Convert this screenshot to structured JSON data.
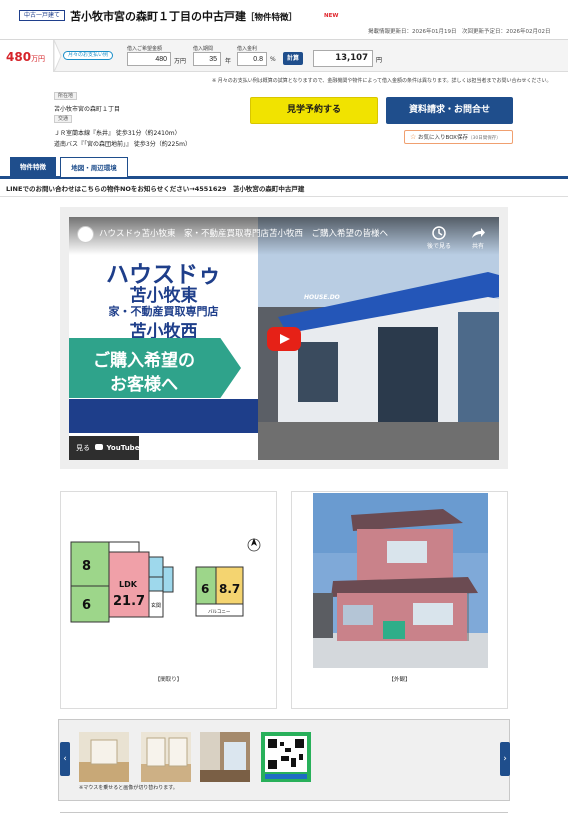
{
  "header": {
    "type_badge": "中古一戸建て",
    "title": "苫小牧市宮の森町１丁目の中古戸建",
    "title_suffix": "［物件特徴］",
    "new_badge": "NEW",
    "dates": "掲載情報更新日：2026年01月19日　次回更新予定日：2026年02月02日"
  },
  "price": {
    "value": "480",
    "unit": "万円",
    "monthly_tag": "月々のお支払い例"
  },
  "loan": {
    "amount_label": "借入ご希望金額",
    "amount_value": "480",
    "amount_unit": "万円",
    "period_label": "借入期間",
    "period_value": "35",
    "period_unit": "年",
    "rate_label": "借入金利",
    "rate_value": "0.8",
    "rate_unit": "%",
    "calc_button": "計算",
    "result_value": "13,107",
    "result_unit": "円"
  },
  "note_top": "※ 月々のお支払い例は概算の試算となりますので、金融機関や物件によって借入金額の条件は異なります。詳しくは担当者までお問い合わせください。",
  "property": {
    "address_tag": "所在地",
    "address": "苫小牧市宮の森町１丁目",
    "traffic_tag": "交通",
    "traffic_1": "ＪＲ室蘭本線『糸井』 徒歩31分（約2410m）",
    "traffic_2": "道南バス『「宮の森団地前」』 徒歩3分（約225m）"
  },
  "actions": {
    "visit": "見学予約する",
    "request": "資料請求・お問合せ",
    "favorite": "お気に入りBOX保存",
    "favorite_note": "（30日間保存）"
  },
  "tabs": [
    {
      "label": "物件特徴"
    },
    {
      "label": "地図・周辺環境"
    }
  ],
  "line_notice": "LINEでのお問い合わせはこちらの物件NOをお知らせください→4551629　苫小牧宮の森町中古戸建",
  "video": {
    "title": "ハウスドゥ苫小牧東　家・不動産買取専門店苫小牧西　ご購入希望の皆様へ",
    "watch_later": "後で見る",
    "share": "共有",
    "big_1": "ハウスドゥ",
    "big_2": "苫小牧東",
    "big_3": "家・不動産買取専門店",
    "big_4": "苫小牧西",
    "big_5": "ご購入希望の",
    "big_6": "お客様へ",
    "sign": "HOUSE.DO",
    "watch_on": "見る",
    "youtube": "YouTube"
  },
  "floorplan": {
    "caption": "【間取り】",
    "rooms_1f": {
      "r8": "8",
      "r6": "6",
      "ldk": "LDK",
      "ldk_size": "21.7",
      "entrance": "玄関"
    },
    "rooms_2f": {
      "r6": "6",
      "r87": "8.7",
      "balcony": "バルコニー"
    }
  },
  "exterior": {
    "caption": "【外観】"
  },
  "thumbs_note": "※マウスを乗せると画像が切り替わります。",
  "colors": {
    "brand_navy": "#1f4e8c",
    "price_red": "#d6242a",
    "visit_yellow": "#f1e300",
    "accent_green": "#2fa38b"
  }
}
